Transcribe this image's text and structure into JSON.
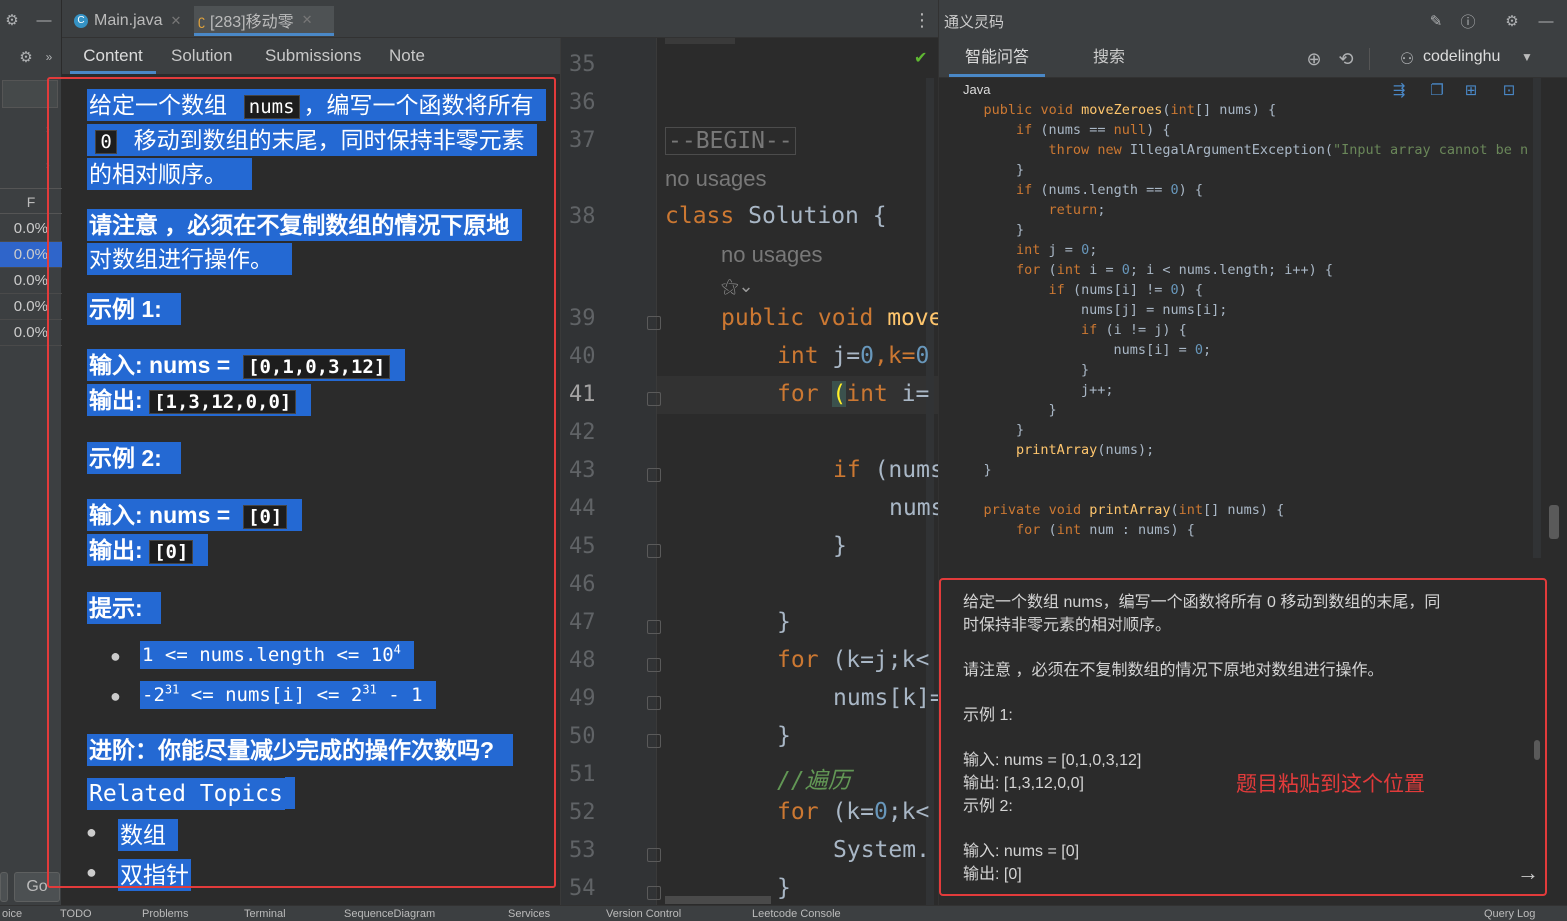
{
  "left_strip": {
    "col_header": "F",
    "percents": [
      "0.0%",
      "0.0%",
      "0.0%",
      "0.0%",
      "0.0%"
    ],
    "go_label": "Go"
  },
  "tabs": [
    {
      "label": "Main.java",
      "icon": "java-class-icon"
    },
    {
      "label": "[283]移动零",
      "icon": "leetcode-icon"
    }
  ],
  "problem": {
    "subtabs": [
      "Content",
      "Solution",
      "Submissions",
      "Note"
    ],
    "desc_1a": "给定一个数组",
    "desc_1_code": "nums",
    "desc_1b": "，编写一个函数将所有",
    "desc_2_code": "0",
    "desc_2b": "移动到数组的末尾，同时保持非零元素",
    "desc_3": "的相对顺序。",
    "note_1": "请注意 ，必须在不复制数组的情况下原地",
    "note_2": "对数组进行操作。",
    "ex1_title": "示例 1:",
    "ex1_input_label": "输入: nums = ",
    "ex1_input_value": "[0,1,0,3,12]",
    "ex1_output_label": "输出:",
    "ex1_output_value": "[1,3,12,0,0]",
    "ex2_title": "示例 2:",
    "ex2_input_label": "输入: nums = ",
    "ex2_input_value": "[0]",
    "ex2_output_label": "输出:",
    "ex2_output_value": "[0]",
    "hint_title": "提示:",
    "hint_1a": "1 <= nums.length <= 10",
    "hint_1sup": "4",
    "hint_2a": "-2",
    "hint_2sup": "31",
    "hint_2b": " <= nums[i] <= 2",
    "hint_2sup2": "31",
    "hint_2c": " - 1",
    "advanced": "进阶：你能尽量减少完成的操作次数吗?",
    "related": "Related Topics",
    "topics": [
      "数组",
      "双指针"
    ]
  },
  "editor": {
    "line_numbers": [
      "35",
      "36",
      "37",
      "38",
      "39",
      "40",
      "41",
      "42",
      "43",
      "44",
      "45",
      "46",
      "47",
      "48",
      "49",
      "50",
      "51",
      "52",
      "53",
      "54"
    ],
    "begin_marker": "--BEGIN--",
    "no_usages_1": "no usages",
    "class_kw": "class",
    "class_name": "Solution {",
    "no_usages_2": "no usages",
    "l39_kw": "public void",
    "l39_rest": "move",
    "l40_kw": "int",
    "l40_a": "j=",
    "l40_n1": "0",
    "l40_b": ",k=",
    "l40_n2": "0",
    "l41_kw": "for",
    "l41_paren": "(",
    "l41_kw2": "int",
    "l41_rest": "i=",
    "l43_kw": "if",
    "l43_rest": "(nums",
    "l44": "nums",
    "l45": "}",
    "l47": "}",
    "l48_kw": "for",
    "l48_rest": "(k=j;k<",
    "l49": "nums[k]=",
    "l50": "}",
    "l51": "//遍历",
    "l52_kw": "for",
    "l52_a": "(k=",
    "l52_n": "0",
    "l52_b": ";k<",
    "l53": "System.",
    "l54": "}"
  },
  "ai": {
    "title": "通义灵码",
    "tab_qa": "智能问答",
    "tab_search": "搜索",
    "user": "codelinghu",
    "code_lang": "Java",
    "code_lines": [
      "    public void moveZeroes(int[] nums) {",
      "        if (nums == null) {",
      "            throw new IllegalArgumentException(\"Input array cannot be n",
      "        }",
      "        if (nums.length == 0) {",
      "            return;",
      "        }",
      "        int j = 0;",
      "        for (int i = 0; i < nums.length; i++) {",
      "            if (nums[i] != 0) {",
      "                nums[j] = nums[i];",
      "                if (i != j) {",
      "                    nums[i] = 0;",
      "                }",
      "                j++;",
      "            }",
      "        }",
      "        printArray(nums);",
      "    }",
      "",
      "    private void printArray(int[] nums) {",
      "        for (int num : nums) {"
    ],
    "input_lines": [
      "给定一个数组 nums，编写一个函数将所有 0 移动到数组的末尾，同",
      "时保持非零元素的相对顺序。",
      "",
      "请注意 ，必须在不复制数组的情况下原地对数组进行操作。",
      "",
      "示例 1:",
      "",
      "输入: nums = [0,1,0,3,12]",
      "输出: [1,3,12,0,0]",
      "示例 2:",
      "",
      "输入: nums = [0]",
      "输出: [0]"
    ],
    "annotation": "题目粘贴到这个位置"
  },
  "status": {
    "items": [
      "TODO",
      "Problems",
      "Terminal",
      "SequenceDiagram",
      "Services",
      "Version Control",
      "Leetcode Console",
      "Query Log"
    ],
    "left_cut": "oice"
  }
}
